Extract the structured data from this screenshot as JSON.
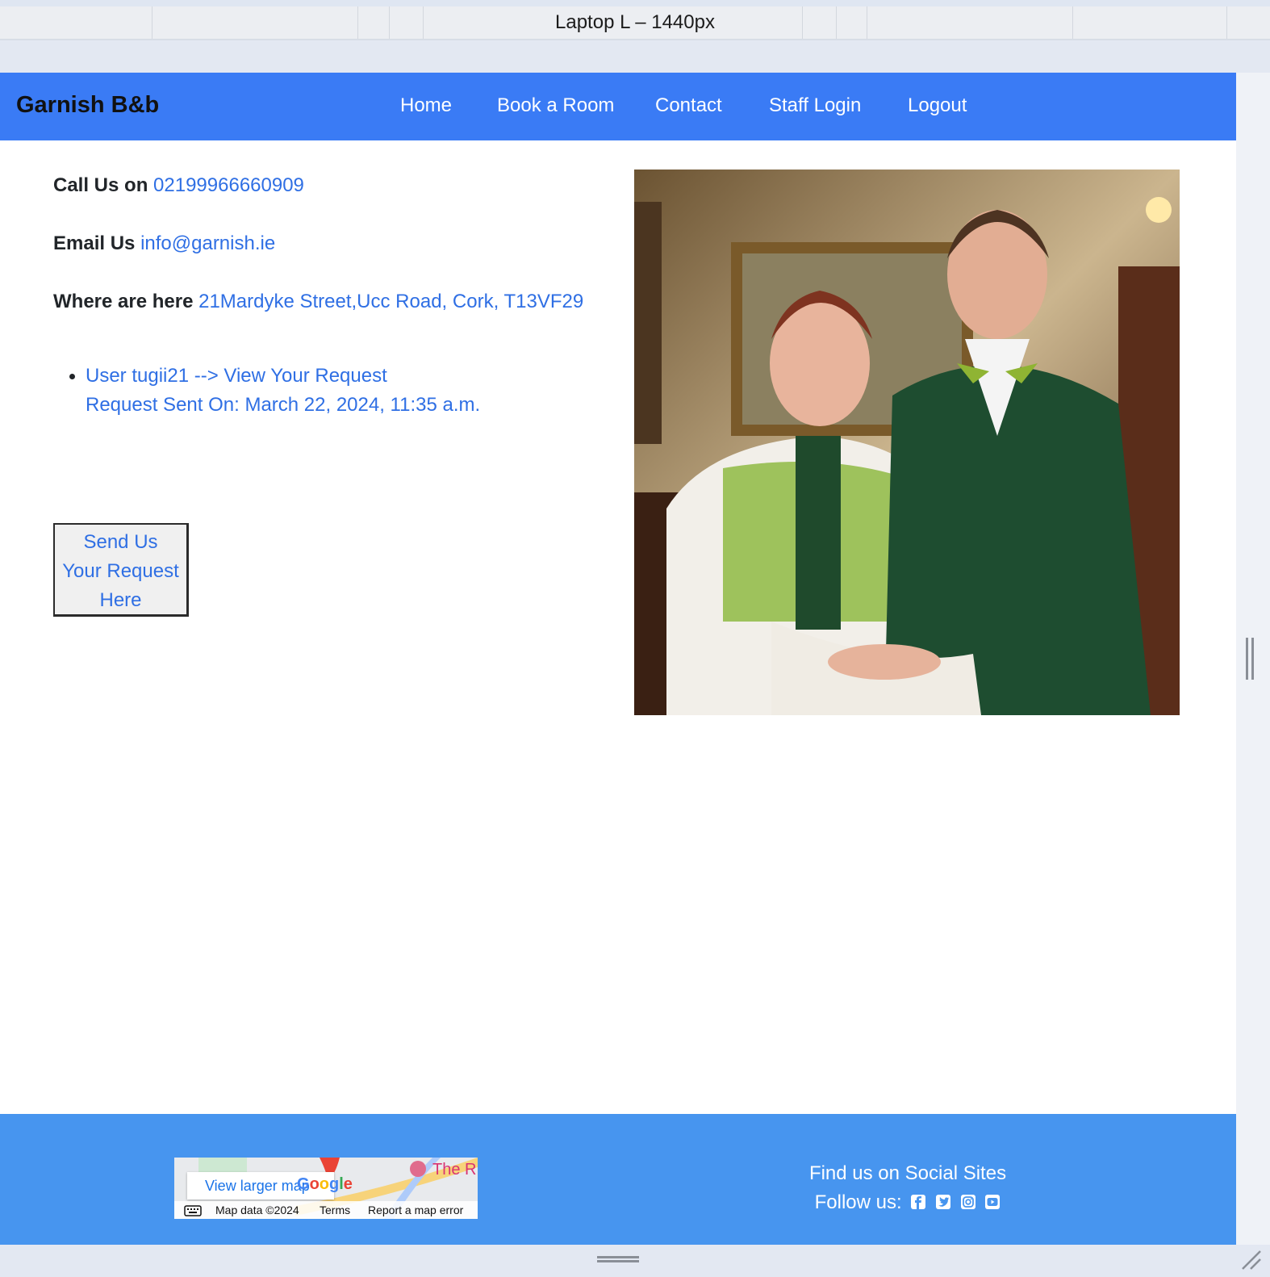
{
  "devtools": {
    "viewport_label": "Laptop L – 1440px"
  },
  "nav": {
    "brand": "Garnish B&b",
    "links": [
      "Home",
      "Book a Room",
      "Contact",
      "Staff Login",
      "Logout"
    ]
  },
  "contact": {
    "call_label": "Call Us on",
    "phone": "02199966660909",
    "email_label": "Email Us",
    "email": "info@garnish.ie",
    "where_label": "Where are here",
    "address": "21Mardyke Street,Ucc Road, Cork, T13VF29"
  },
  "requests": [
    {
      "link_text": "User tugii21 --> View Your Request",
      "sent_text": "Request Sent On: March 22, 2024, 11:35 a.m."
    }
  ],
  "send_button": {
    "line1": "Send Us",
    "line2": "Your Request",
    "line3": "Here"
  },
  "footer": {
    "map": {
      "view_larger": "View larger map",
      "google": "Google",
      "poi": "The R",
      "map_data": "Map data ©2024",
      "terms": "Terms",
      "report": "Report a map error"
    },
    "social_title": "Find us on Social Sites",
    "follow_label": "Follow us:",
    "icons": [
      "facebook-icon",
      "twitter-icon",
      "instagram-icon",
      "youtube-icon"
    ]
  },
  "colors": {
    "nav_bg": "#3a7bf5",
    "footer_bg": "#4795ef",
    "link": "#2f6fe4"
  }
}
